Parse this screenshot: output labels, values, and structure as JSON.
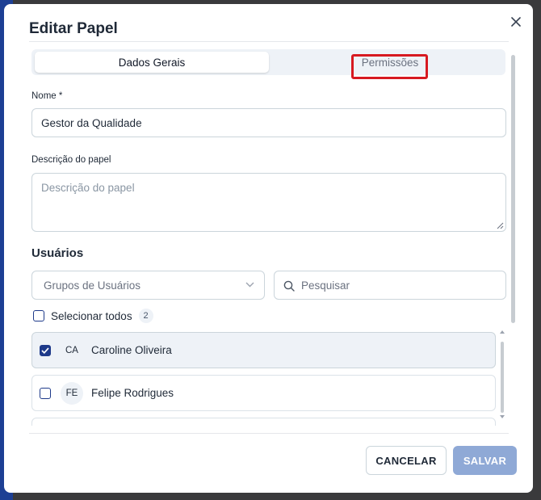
{
  "dialog": {
    "title": "Editar Papel"
  },
  "tabs": [
    {
      "label": "Dados Gerais",
      "active": true
    },
    {
      "label": "Permissões",
      "active": false
    }
  ],
  "form": {
    "name_label": "Nome *",
    "name_value": "Gestor da Qualidade",
    "description_label": "Descrição do papel",
    "description_placeholder": "Descrição do papel"
  },
  "users": {
    "section_title": "Usuários",
    "group_select_value": "Grupos de Usuários",
    "search_placeholder": "Pesquisar",
    "select_all_label": "Selecionar todos",
    "count": "2",
    "items": [
      {
        "initials": "CA",
        "name": "Caroline Oliveira",
        "checked": true
      },
      {
        "initials": "FE",
        "name": "Felipe Rodrigues",
        "checked": false
      }
    ]
  },
  "footer": {
    "cancel_label": "CANCELAR",
    "save_label": "SALVAR"
  },
  "colors": {
    "primary": "#1e3a8a",
    "save_disabled": "#8fa9d6",
    "highlight": "#d71920"
  }
}
